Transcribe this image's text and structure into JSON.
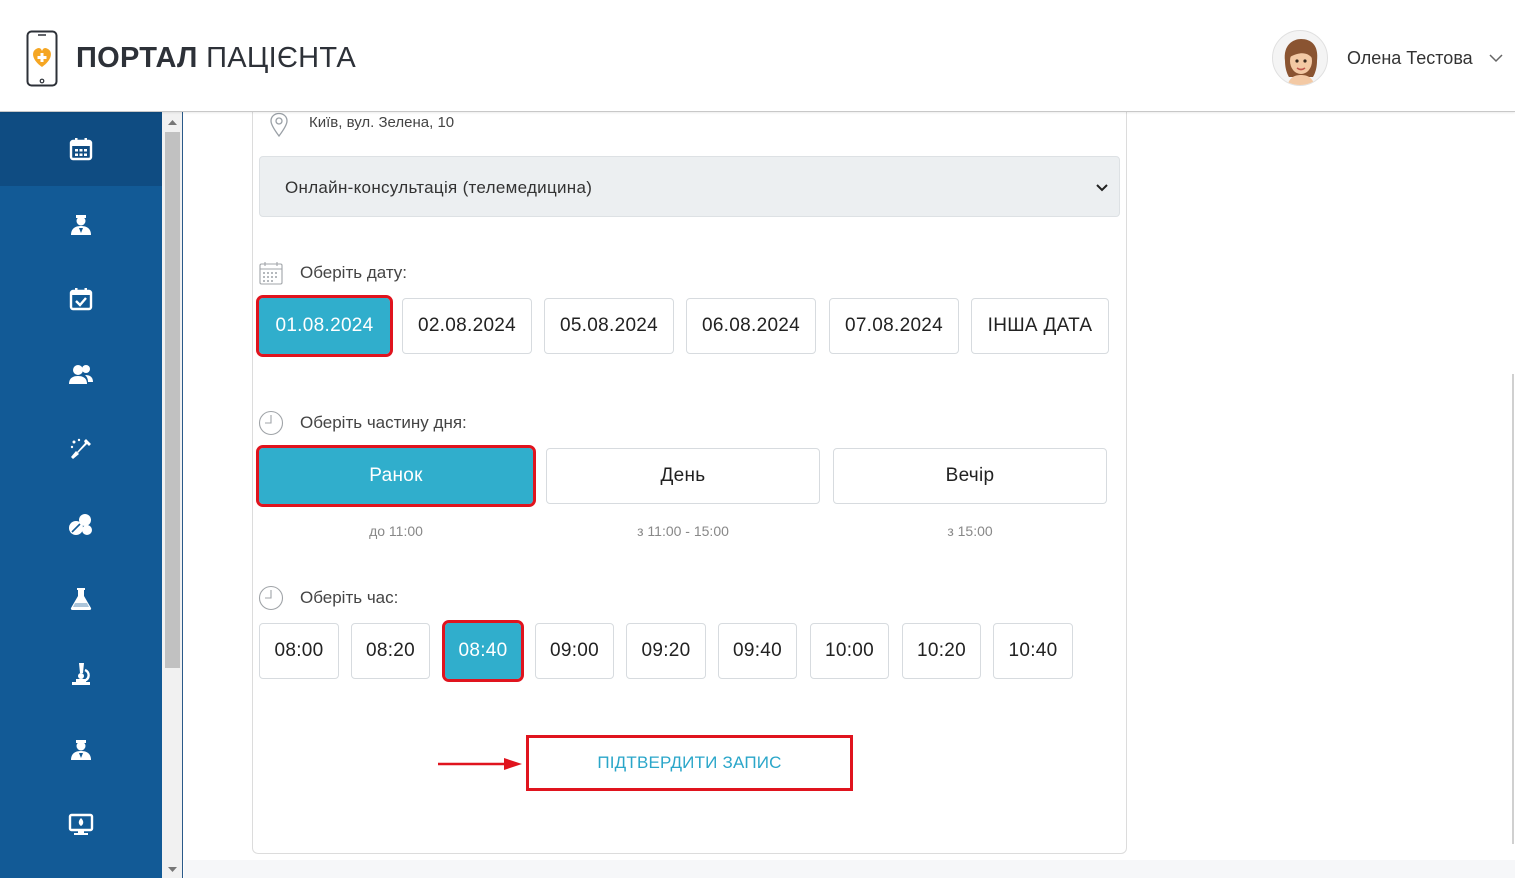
{
  "header": {
    "logo_bold": "ПОРТАЛ",
    "logo_light": "ПАЦІЄНТА",
    "user_name": "Олена Тестова"
  },
  "sidebar": {
    "items": [
      {
        "icon": "calendar-icon",
        "active": true
      },
      {
        "icon": "doctor-icon",
        "active": false
      },
      {
        "icon": "calendar-check-icon",
        "active": false
      },
      {
        "icon": "users-icon",
        "active": false
      },
      {
        "icon": "syringe-icon",
        "active": false
      },
      {
        "icon": "pills-icon",
        "active": false
      },
      {
        "icon": "flask-icon",
        "active": false
      },
      {
        "icon": "microscope-icon",
        "active": false
      },
      {
        "icon": "doctor-alt-icon",
        "active": false
      },
      {
        "icon": "telemedicine-icon",
        "active": false
      }
    ]
  },
  "booking": {
    "address": "Київ, вул. Зелена, 10",
    "service_type": "Онлайн-консультація (телемедицина)",
    "date_label": "Оберіть дату:",
    "dates": [
      "01.08.2024",
      "02.08.2024",
      "05.08.2024",
      "06.08.2024",
      "07.08.2024",
      "ІНША ДАТА"
    ],
    "selected_date": "01.08.2024",
    "daypart_label": "Оберіть частину дня:",
    "dayparts": [
      {
        "label": "Ранок",
        "hint": "до 11:00"
      },
      {
        "label": "День",
        "hint": "з 11:00 - 15:00"
      },
      {
        "label": "Вечір",
        "hint": "з 15:00"
      }
    ],
    "selected_daypart": "Ранок",
    "time_label": "Оберіть час:",
    "times": [
      "08:00",
      "08:20",
      "08:40",
      "09:00",
      "09:20",
      "09:40",
      "10:00",
      "10:20",
      "10:40"
    ],
    "selected_time": "08:40",
    "confirm_label": "ПІДТВЕРДИТИ ЗАПИС"
  },
  "colors": {
    "sidebar": "#125a96",
    "accent": "#30aecc",
    "highlight": "#e0141e"
  }
}
